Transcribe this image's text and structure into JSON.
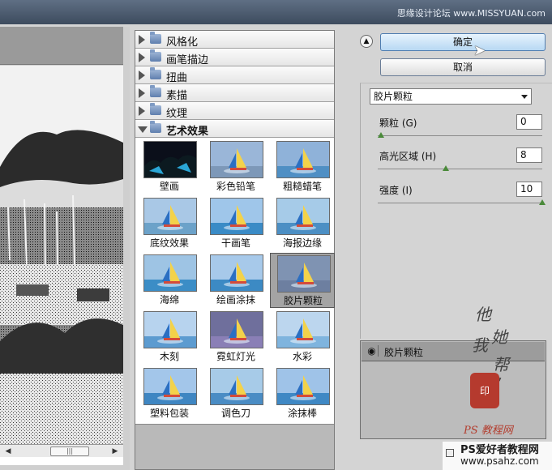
{
  "window": {
    "site_watermark": "思缘设计论坛 www.MISSYUAN.com"
  },
  "categories": [
    {
      "label": "风格化",
      "expanded": false
    },
    {
      "label": "画笔描边",
      "expanded": false
    },
    {
      "label": "扭曲",
      "expanded": false
    },
    {
      "label": "素描",
      "expanded": false
    },
    {
      "label": "纹理",
      "expanded": false
    },
    {
      "label": "艺术效果",
      "expanded": true
    }
  ],
  "artistic_filters": [
    {
      "label": "壁画",
      "selected": false,
      "icon": "fresco-thumb"
    },
    {
      "label": "彩色铅笔",
      "selected": false,
      "icon": "colored-pencil-thumb"
    },
    {
      "label": "粗糙蜡笔",
      "selected": false,
      "icon": "rough-pastels-thumb"
    },
    {
      "label": "底纹效果",
      "selected": false,
      "icon": "underpainting-thumb"
    },
    {
      "label": "干画笔",
      "selected": false,
      "icon": "dry-brush-thumb"
    },
    {
      "label": "海报边缘",
      "selected": false,
      "icon": "poster-edges-thumb"
    },
    {
      "label": "海绵",
      "selected": false,
      "icon": "sponge-thumb"
    },
    {
      "label": "绘画涂抹",
      "selected": false,
      "icon": "paint-daubs-thumb"
    },
    {
      "label": "胶片颗粒",
      "selected": true,
      "icon": "film-grain-thumb"
    },
    {
      "label": "木刻",
      "selected": false,
      "icon": "cutout-thumb"
    },
    {
      "label": "霓虹灯光",
      "selected": false,
      "icon": "neon-glow-thumb"
    },
    {
      "label": "水彩",
      "selected": false,
      "icon": "watercolor-thumb"
    },
    {
      "label": "塑料包装",
      "selected": false,
      "icon": "plastic-wrap-thumb"
    },
    {
      "label": "调色刀",
      "selected": false,
      "icon": "palette-knife-thumb"
    },
    {
      "label": "涂抹棒",
      "selected": false,
      "icon": "smudge-stick-thumb"
    }
  ],
  "buttons": {
    "ok": "确定",
    "cancel": "取消"
  },
  "filter_select": {
    "value": "胶片颗粒"
  },
  "params": [
    {
      "label": "颗粒 (G)",
      "value": "0",
      "fraction": 0.0
    },
    {
      "label": "高光区域 (H)",
      "value": "8",
      "fraction": 0.4
    },
    {
      "label": "强度 (I)",
      "value": "10",
      "fraction": 1.0
    }
  ],
  "layers": [
    {
      "name": "胶片颗粒",
      "visible": true
    }
  ],
  "watermark": {
    "handwriting": [
      "他",
      "她",
      "我",
      "帮",
      "你"
    ],
    "seal": "印",
    "stamp_text": "PS 教程网",
    "brand": "PS爱好者教程网",
    "url": "www.psahz.com"
  },
  "colors": {
    "accent": "#b7d8f3",
    "selected_bg": "#a4a4a4",
    "slider": "#4a8a3a"
  }
}
